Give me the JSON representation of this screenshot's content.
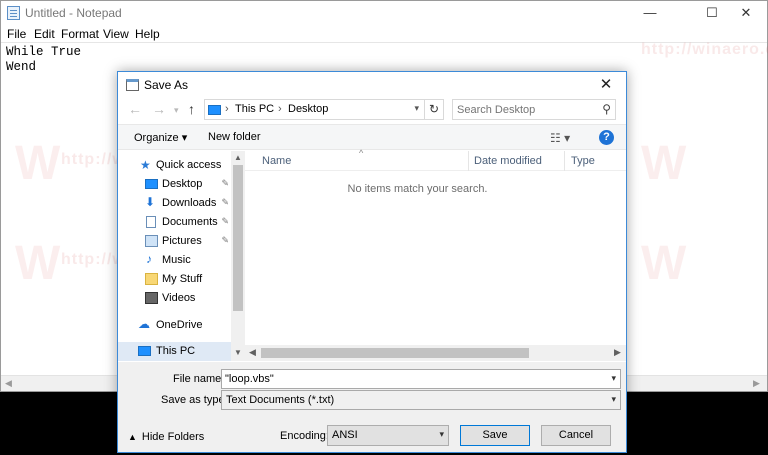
{
  "notepad": {
    "title": "Untitled - Notepad",
    "window_controls": {
      "minimize": "—",
      "maximize": "☐",
      "close": "✕"
    },
    "menu": [
      "File",
      "Edit",
      "Format",
      "View",
      "Help"
    ],
    "content_lines": [
      "While True",
      "Wend"
    ]
  },
  "watermark": {
    "text": "http://winaero.com",
    "logo": "W"
  },
  "dialog": {
    "title": "Save As",
    "close": "✕",
    "nav": {
      "back": "←",
      "forward": "→",
      "up": "↑"
    },
    "address": {
      "crumbs": [
        "This PC",
        "Desktop"
      ],
      "separator": "›",
      "refresh": "↻"
    },
    "search": {
      "placeholder": "Search Desktop"
    },
    "toolbar": {
      "organize": "Organize ▾",
      "new_folder": "New folder",
      "help": "?"
    },
    "nav_items": [
      {
        "label": "Quick access",
        "icon": "star-icon"
      },
      {
        "label": "Desktop",
        "icon": "desktop-icon",
        "pinned": true
      },
      {
        "label": "Downloads",
        "icon": "download-icon",
        "pinned": true
      },
      {
        "label": "Documents",
        "icon": "document-icon",
        "pinned": true
      },
      {
        "label": "Pictures",
        "icon": "picture-icon",
        "pinned": true
      },
      {
        "label": "Music",
        "icon": "music-icon"
      },
      {
        "label": "My Stuff",
        "icon": "folder-icon"
      },
      {
        "label": "Videos",
        "icon": "video-icon"
      },
      {
        "label": "OneDrive",
        "icon": "cloud-icon"
      },
      {
        "label": "This PC",
        "icon": "computer-icon",
        "selected": true
      }
    ],
    "columns": [
      "Name",
      "Date modified",
      "Type"
    ],
    "empty_message": "No items match your search.",
    "form": {
      "file_name_label": "File name:",
      "file_name_value": "\"loop.vbs\"",
      "save_type_label": "Save as type:",
      "save_type_value": "Text Documents (*.txt)",
      "encoding_label": "Encoding:",
      "encoding_value": "ANSI",
      "save_button": "Save",
      "cancel_button": "Cancel",
      "hide_folders": "Hide Folders"
    }
  },
  "colors": {
    "accent": "#0078d7",
    "dialog_border": "#3c8ad8",
    "help": "#1e73d6"
  }
}
